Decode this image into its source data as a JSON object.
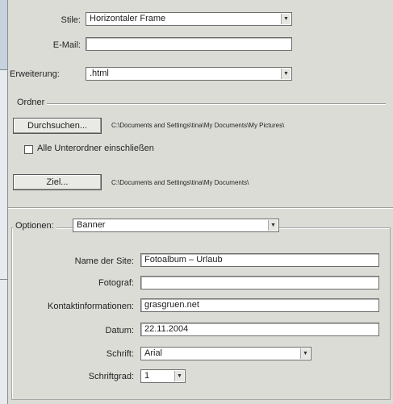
{
  "form": {
    "style_label": "Stile:",
    "style_value": "Horizontaler Frame",
    "email_label": "E-Mail:",
    "email_value": "",
    "extension_label": "Erweiterung:",
    "extension_value": ".html"
  },
  "folders": {
    "section_label": "Ordner",
    "browse_label": "Durchsuchen...",
    "source_path": "C:\\Documents and Settings\\tina\\My Documents\\My Pictures\\",
    "include_subfolders_label": "Alle Unterordner einschließen",
    "include_subfolders_checked": false,
    "target_label": "Ziel...",
    "target_path": "C:\\Documents and Settings\\tina\\My Documents\\"
  },
  "options": {
    "label": "Optionen:",
    "value": "Banner",
    "site_name_label": "Name der Site:",
    "site_name_value": "Fotoalbum – Urlaub",
    "photographer_label": "Fotograf:",
    "photographer_value": "",
    "contact_label": "Kontaktinformationen:",
    "contact_value": "grasgruen.net",
    "date_label": "Datum:",
    "date_value": "22.11.2004",
    "font_label": "Schrift:",
    "font_value": "Arial",
    "font_size_label": "Schriftgrad:",
    "font_size_value": "1"
  },
  "icons": {
    "dropdown": "chevron-down-icon"
  }
}
